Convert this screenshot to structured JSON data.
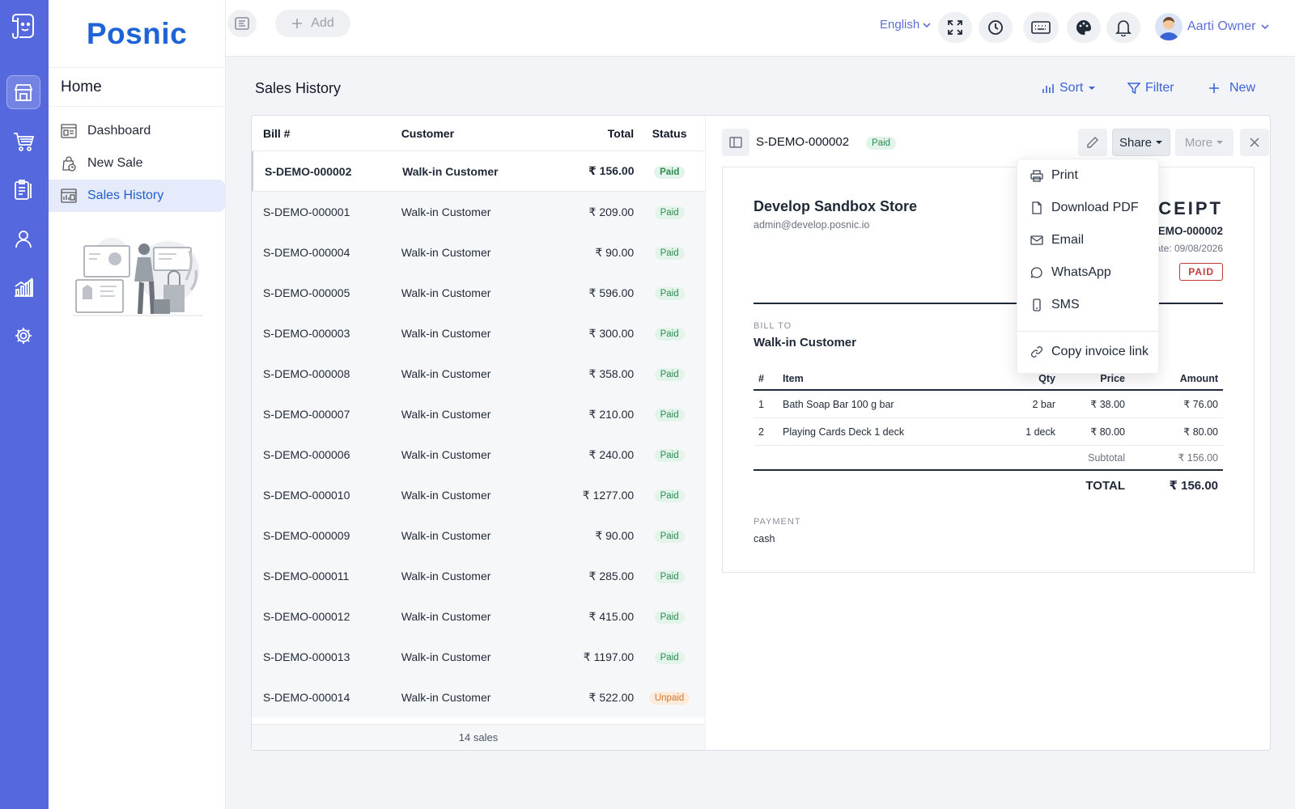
{
  "app": {
    "brand": "Posnic"
  },
  "sidebar": {
    "title": "Home",
    "items": [
      {
        "label": "Dashboard",
        "icon": "dashboard-icon"
      },
      {
        "label": "New Sale",
        "icon": "new-sale-icon"
      },
      {
        "label": "Sales History",
        "icon": "sales-history-icon"
      }
    ]
  },
  "rail": {
    "icons": [
      "store-icon",
      "cart-icon",
      "clipboard-icon",
      "user-icon",
      "chart-icon",
      "gear-icon"
    ]
  },
  "topbar": {
    "add_label": "Add",
    "language": "English",
    "user_name": "Aarti Owner"
  },
  "page": {
    "title": "Sales History",
    "sort_label": "Sort",
    "filter_label": "Filter",
    "new_label": "New"
  },
  "list": {
    "columns": [
      "Bill #",
      "Customer",
      "Total",
      "Status"
    ],
    "rows": [
      {
        "bill": "S-DEMO-000002",
        "customer": "Walk-in Customer",
        "total": "₹ 156.00",
        "status": "Paid"
      },
      {
        "bill": "S-DEMO-000001",
        "customer": "Walk-in Customer",
        "total": "₹ 209.00",
        "status": "Paid"
      },
      {
        "bill": "S-DEMO-000004",
        "customer": "Walk-in Customer",
        "total": "₹ 90.00",
        "status": "Paid"
      },
      {
        "bill": "S-DEMO-000005",
        "customer": "Walk-in Customer",
        "total": "₹ 596.00",
        "status": "Paid"
      },
      {
        "bill": "S-DEMO-000003",
        "customer": "Walk-in Customer",
        "total": "₹ 300.00",
        "status": "Paid"
      },
      {
        "bill": "S-DEMO-000008",
        "customer": "Walk-in Customer",
        "total": "₹ 358.00",
        "status": "Paid"
      },
      {
        "bill": "S-DEMO-000007",
        "customer": "Walk-in Customer",
        "total": "₹ 210.00",
        "status": "Paid"
      },
      {
        "bill": "S-DEMO-000006",
        "customer": "Walk-in Customer",
        "total": "₹ 240.00",
        "status": "Paid"
      },
      {
        "bill": "S-DEMO-000010",
        "customer": "Walk-in Customer",
        "total": "₹ 1277.00",
        "status": "Paid"
      },
      {
        "bill": "S-DEMO-000009",
        "customer": "Walk-in Customer",
        "total": "₹ 90.00",
        "status": "Paid"
      },
      {
        "bill": "S-DEMO-000011",
        "customer": "Walk-in Customer",
        "total": "₹ 285.00",
        "status": "Paid"
      },
      {
        "bill": "S-DEMO-000012",
        "customer": "Walk-in Customer",
        "total": "₹ 415.00",
        "status": "Paid"
      },
      {
        "bill": "S-DEMO-000013",
        "customer": "Walk-in Customer",
        "total": "₹ 1197.00",
        "status": "Paid"
      },
      {
        "bill": "S-DEMO-000014",
        "customer": "Walk-in Customer",
        "total": "₹ 522.00",
        "status": "Unpaid"
      }
    ],
    "footer": "14 sales"
  },
  "detail": {
    "title": "S-DEMO-000002",
    "status": "Paid",
    "share_label": "Share",
    "more_label": "More"
  },
  "receipt": {
    "store": "Develop Sandbox Store",
    "email": "admin@develop.posnic.io",
    "heading": "RECEIPT",
    "number": "S-DEMO-000002",
    "date": "Date: 09/08/2026",
    "stamp": "PAID",
    "bill_to_label": "BILL TO",
    "bill_to": "Walk-in Customer",
    "columns": [
      "#",
      "Item",
      "Qty",
      "Price",
      "Amount"
    ],
    "items": [
      {
        "n": "1",
        "item": "Bath Soap Bar 100 g bar",
        "qty": "2 bar",
        "price": "₹ 38.00",
        "amount": "₹ 76.00"
      },
      {
        "n": "2",
        "item": "Playing Cards Deck 1 deck",
        "qty": "1 deck",
        "price": "₹ 80.00",
        "amount": "₹ 80.00"
      }
    ],
    "subtotal_label": "Subtotal",
    "subtotal": "₹ 156.00",
    "total_label": "TOTAL",
    "total": "₹ 156.00",
    "payment_label": "PAYMENT",
    "payment": "cash"
  },
  "share_menu": {
    "items": [
      {
        "label": "Print",
        "icon": "printer-icon"
      },
      {
        "label": "Download PDF",
        "icon": "file-icon"
      },
      {
        "label": "Email",
        "icon": "mail-icon"
      },
      {
        "label": "WhatsApp",
        "icon": "chat-icon"
      },
      {
        "label": "SMS",
        "icon": "phone-icon"
      },
      {
        "label": "Copy invoice link",
        "icon": "link-icon"
      }
    ]
  },
  "colors": {
    "rail": "#5568dd",
    "brand": "#1f64d6",
    "accent": "#3b63d6",
    "paid": "#2e8a52",
    "unpaid": "#d2782c",
    "stamp": "#c23b3b"
  }
}
